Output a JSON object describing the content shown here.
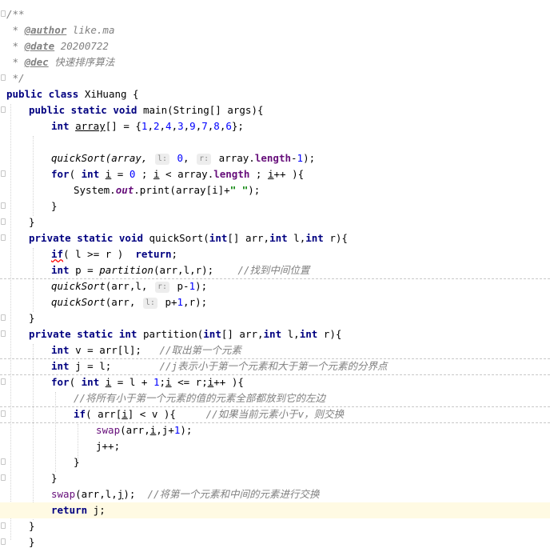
{
  "editor": {
    "lines": [
      {
        "text": "/**"
      },
      {
        "text": " * @author like.ma"
      },
      {
        "text": " * @date 20200722"
      },
      {
        "text": " * @dec 快速排序算法"
      },
      {
        "text": " */"
      },
      {
        "text": "public class XiHuang {"
      },
      {
        "text": "public static void main(String[] args){"
      },
      {
        "text": "int array[] = {1,2,4,3,9,7,8,6};"
      },
      {
        "text": ""
      },
      {
        "text": "quickSort(array, l: 0, r: array.length-1);"
      },
      {
        "text": "for( int i = 0 ; i < array.length ; i++ ){"
      },
      {
        "text": "System.out.print(array[i]+\" \");"
      },
      {
        "text": "}"
      },
      {
        "text": "}"
      },
      {
        "text": "private static void quickSort(int[] arr,int l,int r){"
      },
      {
        "text": "if( l >= r )  return;"
      },
      {
        "text": "int p = partition(arr,l,r);    //找到中间位置"
      },
      {
        "text": "quickSort(arr,l, r: p-1);"
      },
      {
        "text": "quickSort(arr, l: p+1,r);"
      },
      {
        "text": "}"
      },
      {
        "text": "private static int partition(int[] arr,int l,int r){"
      },
      {
        "text": "int v = arr[l];   //取出第一个元素"
      },
      {
        "text": "int j = l;        //j表示小于第一个元素和大于第一个元素的分界点"
      },
      {
        "text": "for( int i = l + 1;i <= r;i++ ){"
      },
      {
        "text": "//将所有小于第一个元素的值的元素全部都放到它的左边"
      },
      {
        "text": "if( arr[i] < v ){     //如果当前元素小于v，则交换"
      },
      {
        "text": "swap(arr,i,j+1);"
      },
      {
        "text": "j++;"
      },
      {
        "text": "}"
      },
      {
        "text": "}"
      },
      {
        "text": "swap(arr,l,j);  //将第一个元素和中间的元素进行交换"
      },
      {
        "text": "return j;"
      },
      {
        "text": "}"
      },
      {
        "text": "}"
      }
    ],
    "tokens": {
      "l1": "/**",
      "l2a": " * ",
      "l2b": "@author",
      "l2c": " like.ma",
      "l3a": " * ",
      "l3b": "@date",
      "l3c": " 20200722",
      "l4a": " * ",
      "l4b": "@dec",
      "l4c": " 快速排序算法",
      "l5": " */",
      "l6a": "public class",
      "l6b": " XiHuang {",
      "l7a": "public static void",
      "l7b": " main(String[] args){",
      "l8a": "int",
      "l8b": " ",
      "l8c": "array",
      "l8d": "[] = {",
      "l8e": "1",
      "l8f": ",",
      "l8g": "2",
      "l8h": ",",
      "l8i": "4",
      "l8j": ",",
      "l8k": "3",
      "l8l": ",",
      "l8m": "9",
      "l8n": ",",
      "l8o": "7",
      "l8p": ",",
      "l8q": "8",
      "l8r": ",",
      "l8s": "6",
      "l8t": "};",
      "l10a": "quickSort(array, ",
      "l10h1": "l:",
      "l10b": " ",
      "l10c": "0",
      "l10d": ", ",
      "l10h2": "r:",
      "l10e": " array.",
      "l10f": "length",
      "l10g": "-",
      "l10i": "1",
      "l10j": ");",
      "l11a": "for",
      "l11b": "( ",
      "l11c": "int",
      "l11d": " ",
      "l11e": "i",
      "l11f": " = ",
      "l11g": "0",
      "l11h": " ; ",
      "l11i": "i",
      "l11j": " < array.",
      "l11k": "length",
      "l11l": " ; ",
      "l11m": "i",
      "l11n": "++ ){",
      "l12a": "System.",
      "l12b": "out",
      "l12c": ".print(array[i]+",
      "l12d": "\" \"",
      "l12e": ");",
      "l13": "}",
      "l14": "}",
      "l15a": "private static void",
      "l15b": " quickSort(",
      "l15c": "int",
      "l15d": "[] arr,",
      "l15e": "int",
      "l15f": " l,",
      "l15g": "int",
      "l15h": " r){",
      "l16a": "if",
      "l16b": "( l >= r )  ",
      "l16c": "return",
      "l16d": ";",
      "l17a": "int",
      "l17b": " p = ",
      "l17c": "partition",
      "l17d": "(arr,l,r);    ",
      "l17e": "//找到中间位置",
      "l18a": "quickSort",
      "l18b": "(arr,l, ",
      "l18h": "r:",
      "l18c": " p-",
      "l18d": "1",
      "l18e": ");",
      "l19a": "quickSort",
      "l19b": "(arr, ",
      "l19h": "l:",
      "l19c": " p+",
      "l19d": "1",
      "l19e": ",r);",
      "l20": "}",
      "l21a": "private static int",
      "l21b": " partition(",
      "l21c": "int",
      "l21d": "[] arr,",
      "l21e": "int",
      "l21f": " l,",
      "l21g": "int",
      "l21h": " r){",
      "l22a": "int",
      "l22b": " v = arr[l];   ",
      "l22c": "//取出第一个元素",
      "l23a": "int",
      "l23b": " j = l;        ",
      "l23c": "//j表示小于第一个元素和大于第一个元素的分界点",
      "l24a": "for",
      "l24b": "( ",
      "l24c": "int",
      "l24d": " ",
      "l24e": "i",
      "l24f": " = l + ",
      "l24g": "1",
      "l24h": ";",
      "l24i": "i",
      "l24j": " <= r;",
      "l24k": "i",
      "l24l": "++ ){",
      "l25": "//将所有小于第一个元素的值的元素全部都放到它的左边",
      "l26a": "if",
      "l26b": "( arr[",
      "l26c": "i",
      "l26d": "] < v ){     ",
      "l26e": "//如果当前元素小于v，则交换",
      "l27a": "swap",
      "l27b": "(arr,",
      "l27c": "i",
      "l27d": ",j+",
      "l27e": "1",
      "l27f": ");",
      "l28": "j++;",
      "l29": "}",
      "l30": "}",
      "l31a": "swap",
      "l31b": "(arr,l,",
      "l31c": "j",
      "l31d": ");  ",
      "l31e": "//将第一个元素和中间的元素进行交换",
      "l32a": "return",
      "l32b": " j;",
      "l33": "}",
      "l34": "}"
    }
  }
}
